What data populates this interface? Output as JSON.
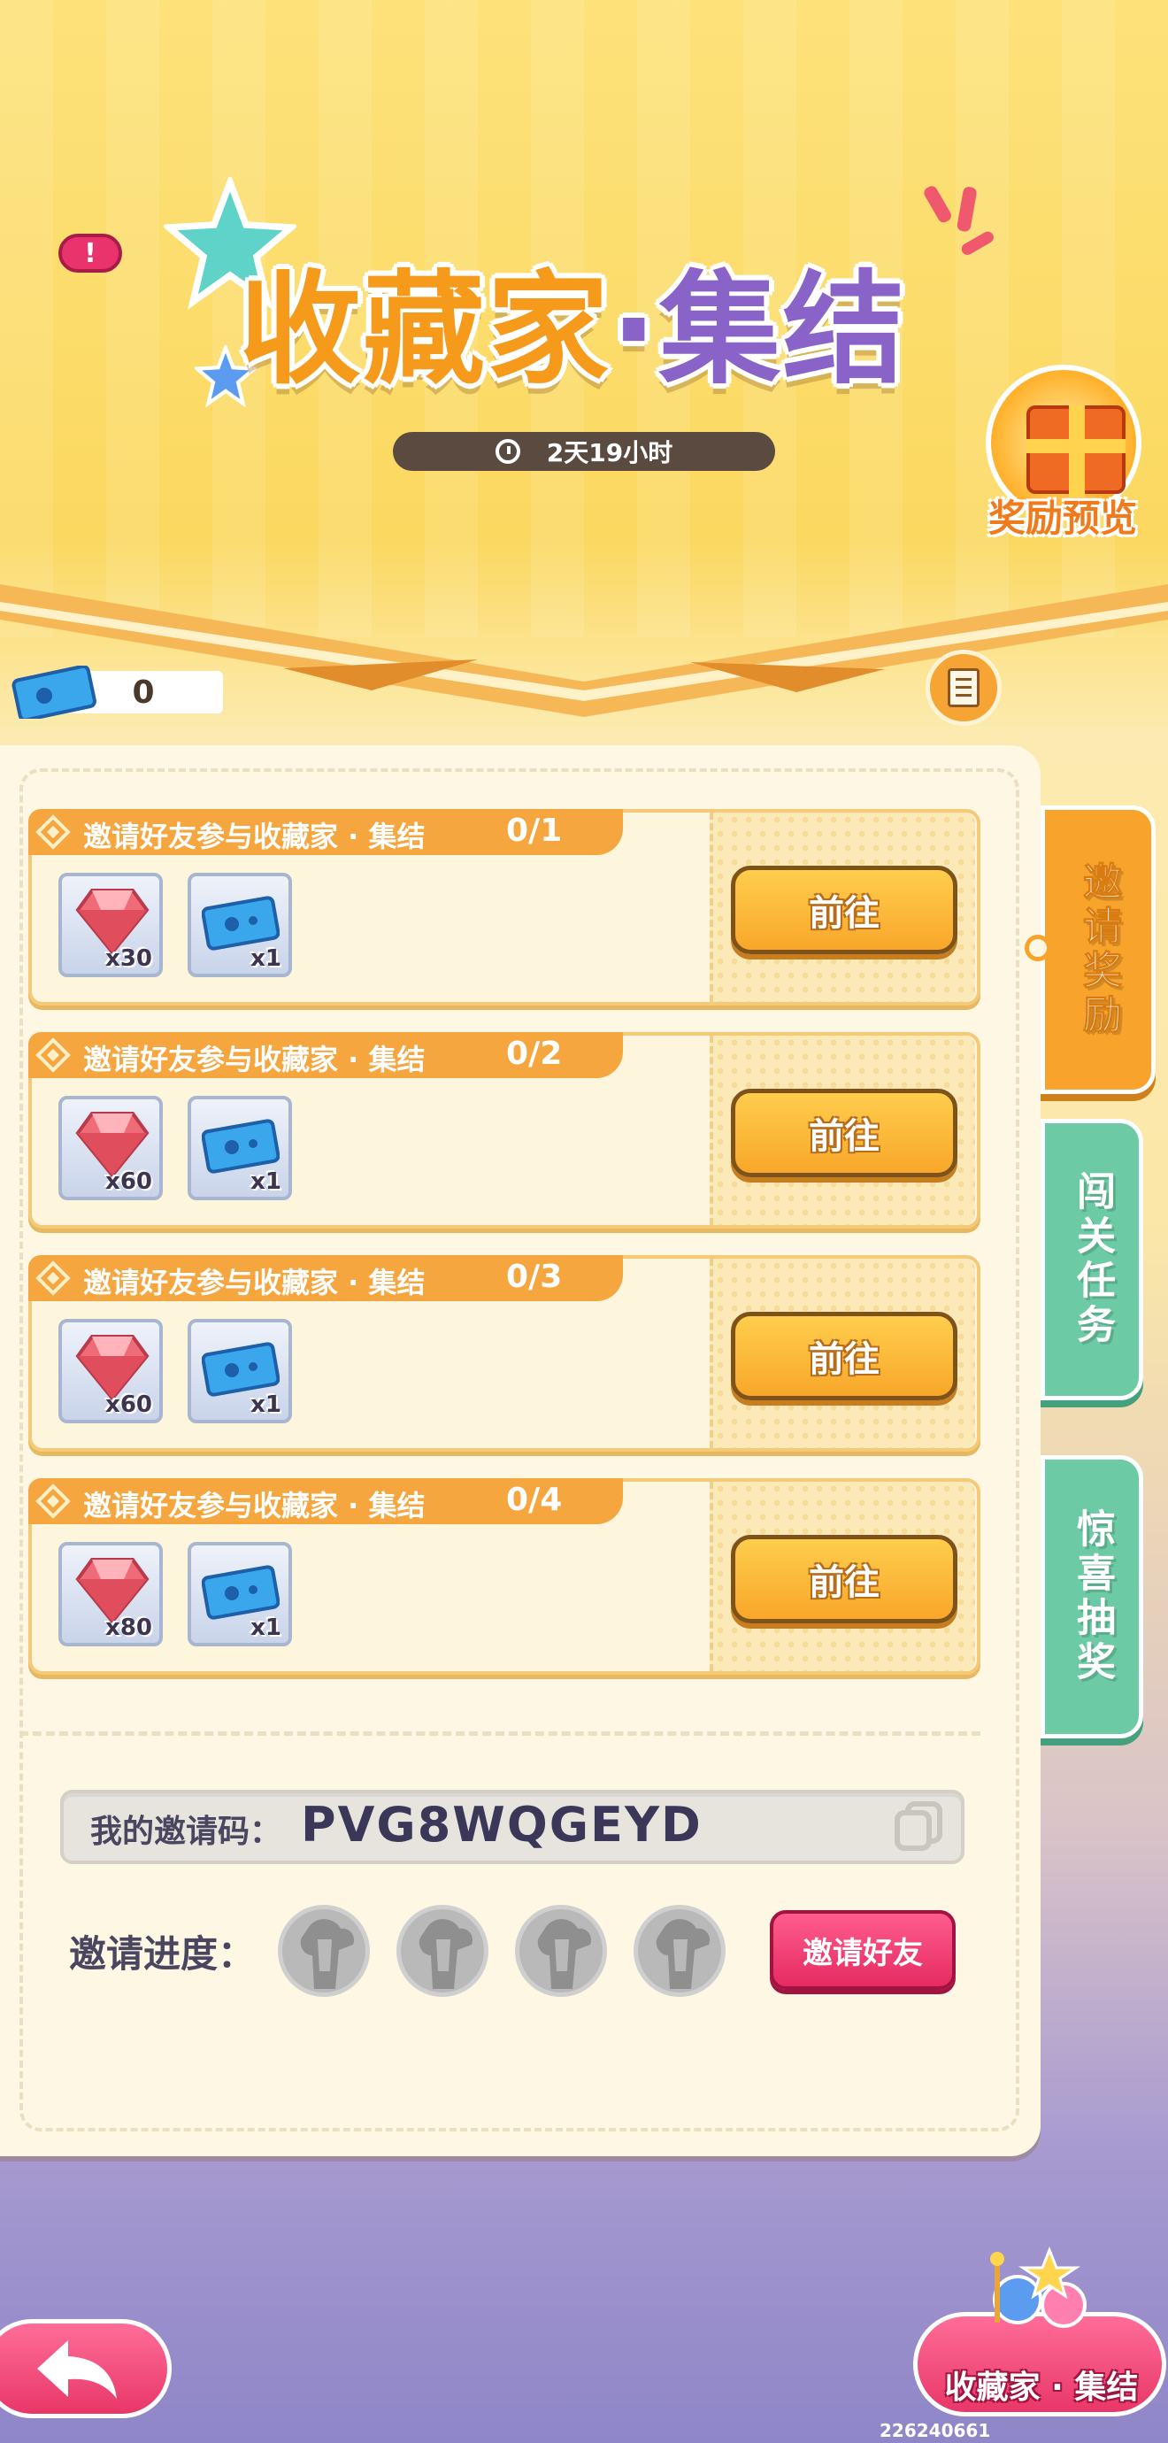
{
  "header": {
    "title_part1": "收藏家",
    "title_dot": "·",
    "title_part2": "集结",
    "countdown": "2天19小时",
    "alert_icon": "!",
    "reward_preview_label": "奖励预览"
  },
  "currency": {
    "ticket_count": "0"
  },
  "tasks": [
    {
      "title": "邀请好友参与收藏家 · 集结",
      "progress": "0/1",
      "rewards": [
        {
          "icon": "red-gem",
          "count": "x30"
        },
        {
          "icon": "blue-ticket",
          "count": "x1"
        }
      ],
      "button": "前往"
    },
    {
      "title": "邀请好友参与收藏家 · 集结",
      "progress": "0/2",
      "rewards": [
        {
          "icon": "red-gem",
          "count": "x60"
        },
        {
          "icon": "blue-ticket",
          "count": "x1"
        }
      ],
      "button": "前往"
    },
    {
      "title": "邀请好友参与收藏家 · 集结",
      "progress": "0/3",
      "rewards": [
        {
          "icon": "red-gem",
          "count": "x60"
        },
        {
          "icon": "blue-ticket",
          "count": "x1"
        }
      ],
      "button": "前往"
    },
    {
      "title": "邀请好友参与收藏家 · 集结",
      "progress": "0/4",
      "rewards": [
        {
          "icon": "red-gem",
          "count": "x80"
        },
        {
          "icon": "blue-ticket",
          "count": "x1"
        }
      ],
      "button": "前往"
    }
  ],
  "side_tabs": [
    {
      "label": "邀请奖励",
      "active": true
    },
    {
      "label": "闯关任务",
      "active": false
    },
    {
      "label": "惊喜抽奖",
      "active": false
    }
  ],
  "invite": {
    "code_label": "我的邀请码：",
    "code_value": "PVG8WQGEYD",
    "progress_label": "邀请进度：",
    "invited_count": 0,
    "slots_total": 4,
    "invite_button": "邀请好友"
  },
  "footer": {
    "event_button": "收藏家 · 集结",
    "uid": "226240661"
  },
  "colors": {
    "accent_orange": "#f5a63f",
    "title_purple": "#8a63c9",
    "tab_teal": "#6ccba4",
    "invite_pink": "#e52b62"
  }
}
